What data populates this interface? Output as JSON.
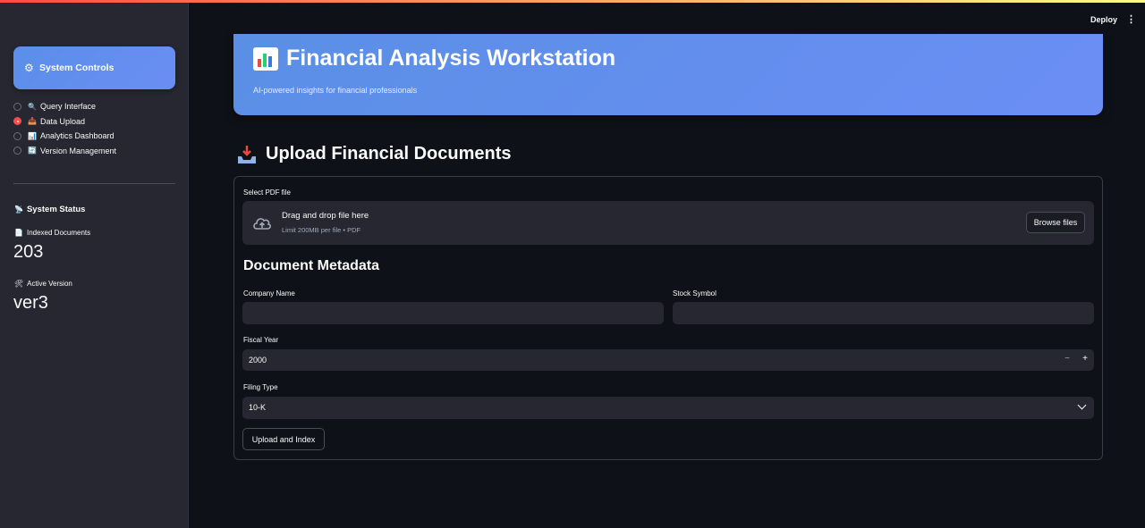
{
  "header": {
    "deploy_label": "Deploy",
    "menu_icon": "vertical-ellipsis-icon"
  },
  "sidebar": {
    "controls_title": "System Controls",
    "controls_icon": "gear-icon",
    "nav": [
      {
        "label": "Query Interface",
        "icon": "magnifier-icon",
        "selected": false
      },
      {
        "label": "Data Upload",
        "icon": "inbox-tray-icon",
        "selected": true
      },
      {
        "label": "Analytics Dashboard",
        "icon": "bar-chart-icon",
        "selected": false
      },
      {
        "label": "Version Management",
        "icon": "refresh-icon",
        "selected": false
      }
    ],
    "status_title": "System Status",
    "indexed_label": "Indexed Documents",
    "indexed_value": "203",
    "version_label": "Active Version",
    "version_value": "ver3"
  },
  "hero": {
    "title": "Financial Analysis Workstation",
    "subtitle": "AI-powered insights for financial professionals",
    "icon": "bar-chart-icon"
  },
  "upload": {
    "section_title": "Upload Financial Documents",
    "file_label": "Select PDF file",
    "dropzone_text": "Drag and drop file here",
    "dropzone_limit": "Limit 200MB per file • PDF",
    "browse_label": "Browse files",
    "metadata_title": "Document Metadata",
    "company_label": "Company Name",
    "company_value": "",
    "symbol_label": "Stock Symbol",
    "symbol_value": "",
    "year_label": "Fiscal Year",
    "year_value": "2000",
    "minus": "−",
    "plus": "+",
    "filing_label": "Filing Type",
    "filing_value": "10-K",
    "submit_label": "Upload and Index"
  },
  "colors": {
    "accent": "#ff4b4b",
    "hero_start": "#5a8fe5",
    "hero_end": "#6b8ef5",
    "background": "#0e1117",
    "sidebar": "#262730"
  }
}
